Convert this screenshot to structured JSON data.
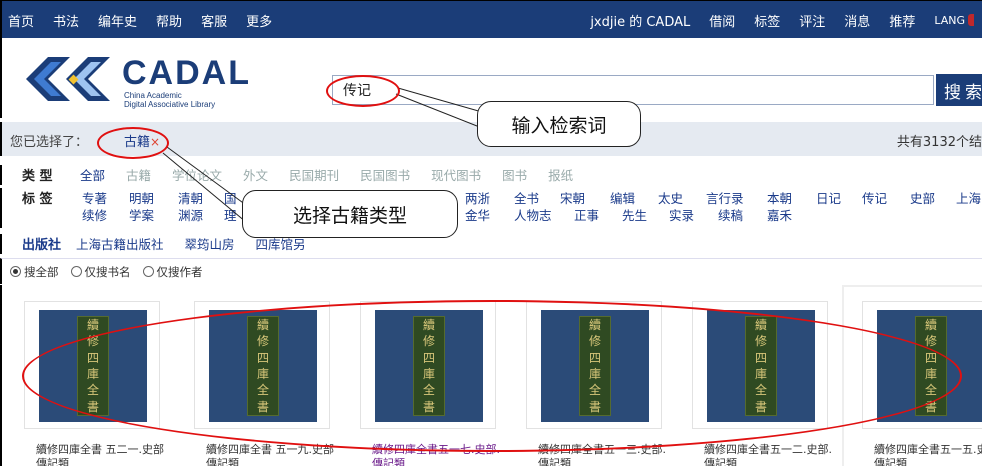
{
  "topbar": {
    "left": [
      "首页",
      "书法",
      "编年史",
      "帮助",
      "客服",
      "更多"
    ],
    "right": [
      "jxdjie 的 CADAL",
      "借阅",
      "标签",
      "评注",
      "消息",
      "推荐"
    ],
    "lang": "LANG"
  },
  "logo": {
    "name": "CADAL",
    "line1": "China Academic",
    "line2": "Digital Associative Library",
    "colors": {
      "navy": "#1b3d78",
      "blue": "#3f7bd1",
      "light": "#9ec3f0",
      "yellow": "#f2c230"
    }
  },
  "search": {
    "value": "传记",
    "button": "搜索"
  },
  "selection": {
    "label": "您已选择了：",
    "tag": "古籍",
    "remove": "×",
    "count": "共有3132个结"
  },
  "types": {
    "label": "类  型",
    "items": [
      "全部",
      "古籍",
      "学位论文",
      "外文",
      "民国期刊",
      "民国图书",
      "现代图书",
      "图书",
      "报纸"
    ]
  },
  "tags": {
    "label": "标  签",
    "row1": [
      "专著",
      "明朝",
      "清朝",
      "国",
      "两浙",
      "全书",
      "宋朝",
      "编辑",
      "太史",
      "言行录",
      "本朝",
      "日记",
      "传记",
      "史部",
      "上海"
    ],
    "row2": [
      "续修",
      "学案",
      "渊源",
      "理",
      "金华",
      "人物志",
      "正事",
      "先生",
      "实录",
      "续稿",
      "嘉禾"
    ]
  },
  "publishers": {
    "label": "出版社",
    "items": [
      "上海古籍出版社",
      "翠筠山房",
      "四库馆另"
    ]
  },
  "scope": [
    "搜全部",
    "仅搜书名",
    "仅搜作者"
  ],
  "books": [
    {
      "title1": "續修四庫全書 五二一.史部",
      "title2": "傳記類",
      "purple": false
    },
    {
      "title1": "續修四庫全書 五一九.史部",
      "title2": "傳記類",
      "purple": false
    },
    {
      "title1": "續修四庫全書五一七.史部.",
      "title2": "傳記類",
      "purple": true
    },
    {
      "title1": "續修四庫全書五一三.史部.",
      "title2": "傳記類",
      "purple": false
    },
    {
      "title1": "續修四庫全書五一二.史部.",
      "title2": "傳記類",
      "purple": false
    },
    {
      "title1": "續修四庫全書五一五.史部",
      "title2": "傳記類",
      "purple": false
    }
  ],
  "cover_glyphs": [
    "續",
    "修",
    "四",
    "庫",
    "全",
    "書"
  ],
  "annotations": {
    "callout_search": "输入检索词",
    "callout_type": "选择古籍类型"
  },
  "colors": {
    "nav": "#1b3d78",
    "annotation": "#e01010"
  }
}
